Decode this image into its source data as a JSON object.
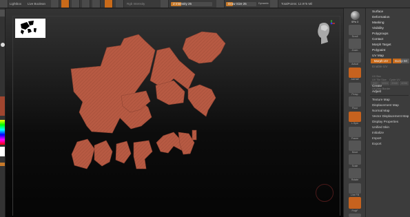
{
  "topbar": {
    "lightbox": "Lightbox",
    "live_boolean": "Live Boolean",
    "rgb_intensity": "Rgb Intensity",
    "z_intensity": "Z Intensity 25",
    "z_intensity_value": 25,
    "draw_size": "Draw Size 25",
    "draw_size_value": 25,
    "dynamic": "Dynamic",
    "total_points": "TotalPoints: 12.975 Mil"
  },
  "right_strip": {
    "spix": "SPix 3",
    "labels": [
      "Scroll",
      "Zoom",
      "Actual",
      "AAHalf",
      "Persp",
      "Floor",
      "L.Sym",
      "Frame",
      "Move",
      "Scale",
      "Rotate",
      "Line Fill",
      "PolyF",
      "Transp",
      "Solo"
    ]
  },
  "panel": {
    "items_top": [
      "Surface",
      "Deformation",
      "Masking",
      "Visibility",
      "Polygroups",
      "Contact",
      "Morph Target",
      "Polypaint",
      "UV Map"
    ],
    "morph_uv": "Morph UV",
    "bump_label": "Bump 50",
    "bump_value": 50,
    "uv_dim": [
      "Enable UV",
      "UV Box",
      "Cycle UV",
      "UV Tile Size",
      "UV Map Border"
    ],
    "uv_sizes": [
      "512",
      "1024",
      "2048",
      "4096"
    ],
    "create": "Create",
    "adjust": "Adjust",
    "maps": [
      "Texture Map",
      "Displacement Map",
      "Normal Map",
      "Vector Displacement Map",
      "Display Properties",
      "Unified Skin",
      "Initialize",
      "Import",
      "Export"
    ]
  },
  "colors": {
    "accent": "#c86a1a",
    "uv_island": "#b75a43"
  },
  "icons": [
    "head-navigation-icon",
    "material-sphere-icon",
    "color-picker-icon"
  ]
}
